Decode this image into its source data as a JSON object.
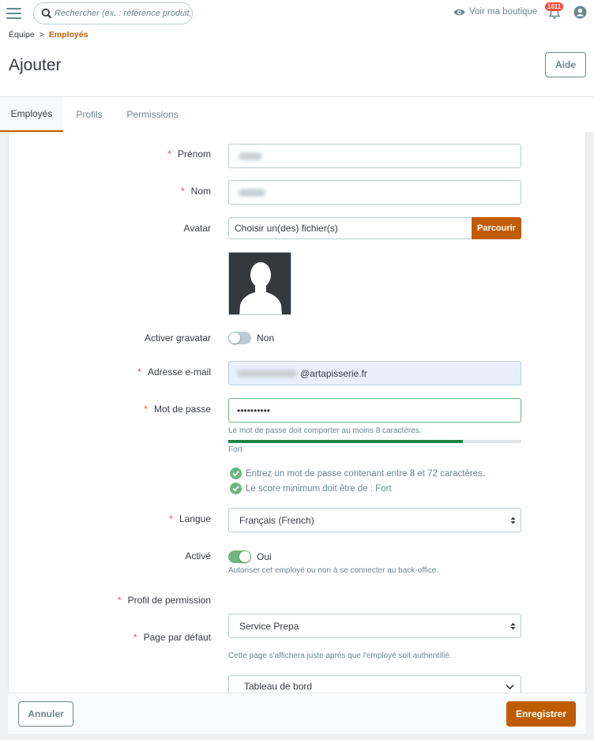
{
  "topbar": {
    "search_placeholder": "Rechercher (ex. : référence produit, no",
    "view_shop": "Voir ma boutique",
    "notifications_count": "1611"
  },
  "breadcrumb": {
    "parent": "Équipe",
    "separator": ">",
    "current": "Employés"
  },
  "page": {
    "title": "Ajouter",
    "help_button": "Aide"
  },
  "tabs": [
    {
      "label": "Employés",
      "active": true
    },
    {
      "label": "Profils",
      "active": false
    },
    {
      "label": "Permissions",
      "active": false
    }
  ],
  "form": {
    "first_name": {
      "label": "Prénom",
      "required": true
    },
    "last_name": {
      "label": "Nom",
      "required": true
    },
    "avatar": {
      "label": "Avatar",
      "file_placeholder": "Choisir un(des) fichier(s)",
      "browse_button": "Parcourir"
    },
    "gravatar": {
      "label": "Activer gravatar",
      "state_label": "Non",
      "enabled": false
    },
    "email": {
      "label": "Adresse e-mail",
      "required": true,
      "domain": "@artapisserie.fr"
    },
    "password": {
      "label": "Mot de passe",
      "required": true,
      "value": "••••••••••",
      "hint": "Le mot de passe doit comporter au moins 8 caractères.",
      "strength_label": "Fort",
      "strength_fraction": 0.8,
      "checks": [
        "Entrez un mot de passe contenant entre 8 et 72 caractères.",
        "Le score minimum doit être de : Fort"
      ]
    },
    "language": {
      "label": "Langue",
      "required": true,
      "value": "Français (French)"
    },
    "active": {
      "label": "Activé",
      "state_label": "Oui",
      "enabled": true,
      "hint": "Autoriser cet employé ou non à se connecter au back-office."
    },
    "profile": {
      "label": "Profil de permission",
      "required": true,
      "value": "Service Prepa"
    },
    "default_page": {
      "label": "Page par défaut",
      "required": true,
      "value": "Tableau de bord",
      "hint": "Cette page s'affichera juste après que l'employé soit authentifié."
    }
  },
  "footer": {
    "cancel_button": "Annuler",
    "save_button": "Enregistrer"
  },
  "colors": {
    "accent": "#c05c00",
    "success": "#70b580",
    "required": "#f54c3e"
  }
}
